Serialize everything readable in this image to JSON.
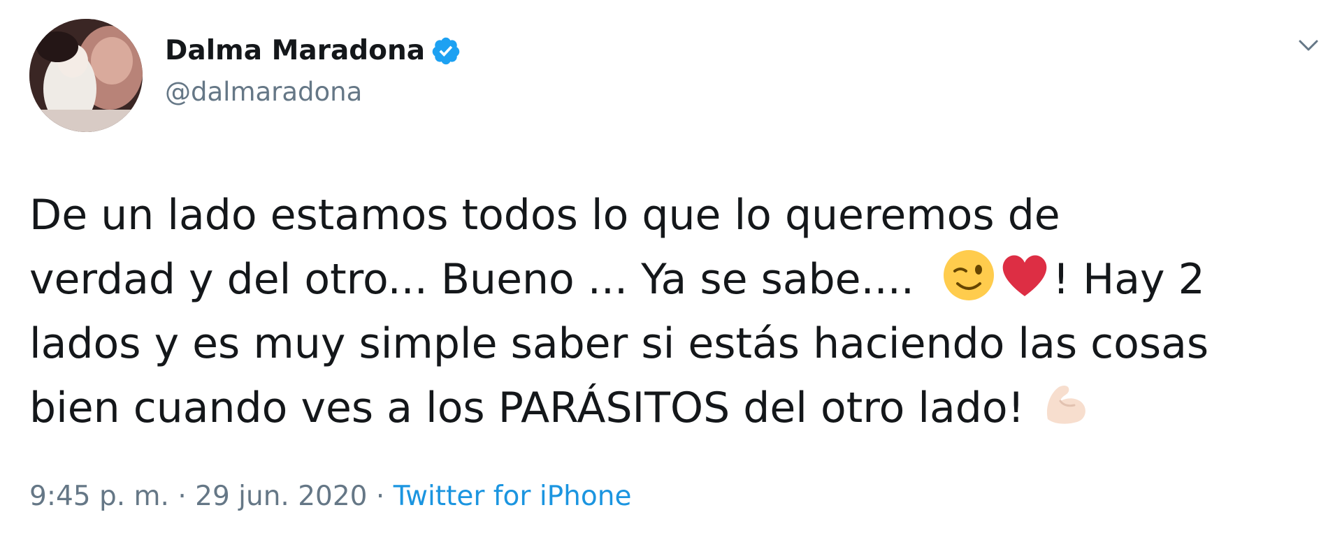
{
  "author": {
    "display_name": "Dalma Maradona",
    "handle": "@dalmaradona",
    "verified_icon": "verified-badge-icon",
    "avatar": "profile-avatar"
  },
  "tweet": {
    "line1": "De un lado estamos todos lo que lo queremos de",
    "line2_a": "verdad y del otro... Bueno ... Ya se sabe....",
    "line2_emoji1": "winking-face-emoji",
    "line2_emoji2": "red-heart-emoji",
    "line2_b": "! Hay 2",
    "line3": "lados y es muy simple saber si estás haciendo las cosas",
    "line4": "bien cuando ves a los PARÁSITOS del otro lado!",
    "line4_emoji": "flexed-biceps-emoji"
  },
  "meta": {
    "time": "9:45 p. m.",
    "separator": "·",
    "date": "29 jun. 2020",
    "source": "Twitter for iPhone"
  },
  "menu_icon": "chevron-down-icon",
  "colors": {
    "verified": "#1da1f2",
    "secondary_text": "#657786",
    "link": "#1b95e0",
    "text": "#14171a"
  }
}
